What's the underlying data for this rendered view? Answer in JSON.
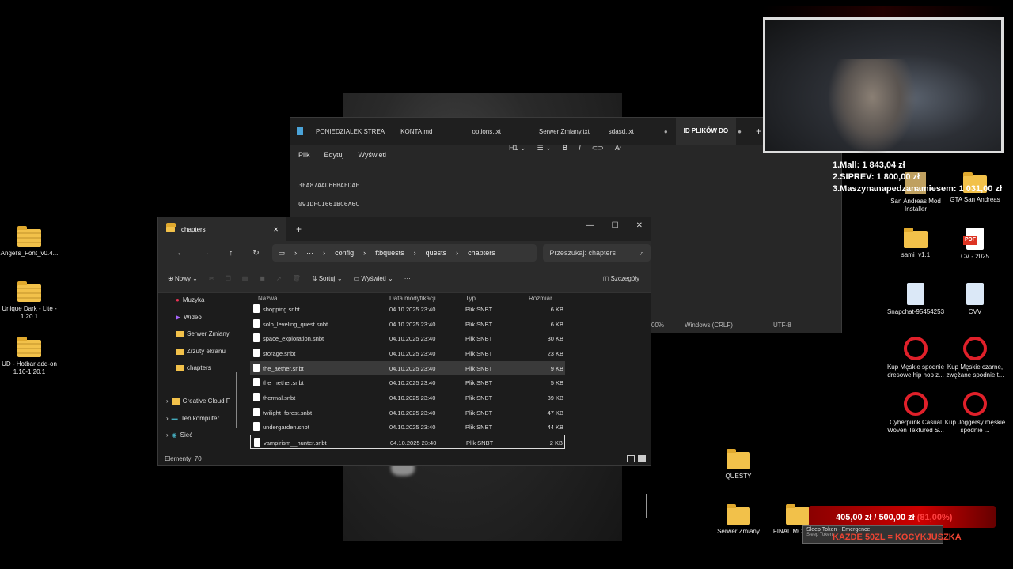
{
  "desktop": {
    "left_icons": [
      {
        "label": "Angel's_Font_v0.4...",
        "type": "zip"
      },
      {
        "label": "Unique Dark - Lite - 1.20.1",
        "type": "zip"
      },
      {
        "label": "UD - Hotbar add-on 1.16-1.20.1",
        "type": "zip"
      }
    ],
    "right_icons": [
      {
        "label": "San Andreas Mod Installer",
        "type": "app"
      },
      {
        "label": "GTA San Andreas",
        "type": "folder"
      },
      {
        "label": "sami_v1.1",
        "type": "folder"
      },
      {
        "label": "CV - 2025",
        "type": "pdf"
      },
      {
        "label": "Snapchat-95454253",
        "type": "image"
      },
      {
        "label": "CVV",
        "type": "image"
      },
      {
        "label": "Kup Męskie spodnie dresowe hip hop z...",
        "type": "opera"
      },
      {
        "label": "Kup Męskie czarne, zwężane spodnie t...",
        "type": "opera"
      },
      {
        "label": "Cyberpunk Casual Woven Textured S...",
        "type": "opera"
      },
      {
        "label": "Kup Joggersy męskie spodnie ...",
        "type": "opera"
      },
      {
        "label": "QUESTY",
        "type": "folder"
      },
      {
        "label": "Serwer Zmiany",
        "type": "folder"
      },
      {
        "label": "FINAL MODYFI...",
        "type": "folder"
      }
    ]
  },
  "notepad": {
    "tabs": [
      "PONIEDZIALEK STREA",
      "KONTA.md",
      "options.txt",
      "Serwer Zmiany.txt",
      "sdasd.txt",
      "ID PLIKÓW DO"
    ],
    "menu": [
      "Plik",
      "Edytuj",
      "Wyświetl"
    ],
    "heading_select": "H1",
    "lines": [
      "3FA87AAD66BAFDAF",
      "091DFC1661BC6A6C"
    ],
    "status_zoom": "00%",
    "status_eol": "Windows (CRLF)",
    "status_enc": "UTF-8"
  },
  "explorer": {
    "tab_title": "chapters",
    "breadcrumb": [
      "config",
      "ftbquests",
      "quests",
      "chapters"
    ],
    "search_placeholder": "Przeszukaj: chapters",
    "toolbar": {
      "new": "Nowy",
      "sort": "Sortuj",
      "view": "Wyświetl",
      "details": "Szczegóły"
    },
    "sidebar": [
      "Muzyka",
      "Wideo",
      "Serwer Zmiany",
      "Zrzuty ekranu",
      "chapters",
      "Creative Cloud F",
      "Ten komputer",
      "Sieć"
    ],
    "columns": [
      "Nazwa",
      "Data modyfikacji",
      "Typ",
      "Rozmiar"
    ],
    "rows": [
      [
        "shopping.snbt",
        "04.10.2025 23:40",
        "Plik SNBT",
        "6 KB"
      ],
      [
        "solo_leveling_quest.snbt",
        "04.10.2025 23:40",
        "Plik SNBT",
        "6 KB"
      ],
      [
        "space_exploration.snbt",
        "04.10.2025 23:40",
        "Plik SNBT",
        "30 KB"
      ],
      [
        "storage.snbt",
        "04.10.2025 23:40",
        "Plik SNBT",
        "23 KB"
      ],
      [
        "the_aether.snbt",
        "04.10.2025 23:40",
        "Plik SNBT",
        "9 KB"
      ],
      [
        "the_nether.snbt",
        "04.10.2025 23:40",
        "Plik SNBT",
        "5 KB"
      ],
      [
        "thermal.snbt",
        "04.10.2025 23:40",
        "Plik SNBT",
        "39 KB"
      ],
      [
        "twilight_forest.snbt",
        "04.10.2025 23:40",
        "Plik SNBT",
        "47 KB"
      ],
      [
        "undergarden.snbt",
        "04.10.2025 23:40",
        "Plik SNBT",
        "44 KB"
      ],
      [
        "vampirism__hunter.snbt",
        "04.10.2025 23:40",
        "Plik SNBT",
        "2 KB"
      ]
    ],
    "status": "Elementy: 70"
  },
  "stream": {
    "ranking": [
      "1.Mall: 1 843,04 zł",
      "2.SIPREV: 1 800,00 zł",
      "3.Maszynanapedzanamiesem: 1 031,00 zł"
    ],
    "donation_amount": "405,00 zł",
    "donation_goal": "/ 500,00 zł",
    "donation_pct": "(81,00%)",
    "donation_sub": "KAZDE 50ZL = KOCYKJUSZKA",
    "sleep_line1": "Sleep Token - Emergence",
    "sleep_line2": "Sleep Token"
  },
  "colors": {
    "accent_folder": "#f2c14a",
    "donation_bar": "#c00000",
    "window_bg": "#1c1c1c"
  }
}
